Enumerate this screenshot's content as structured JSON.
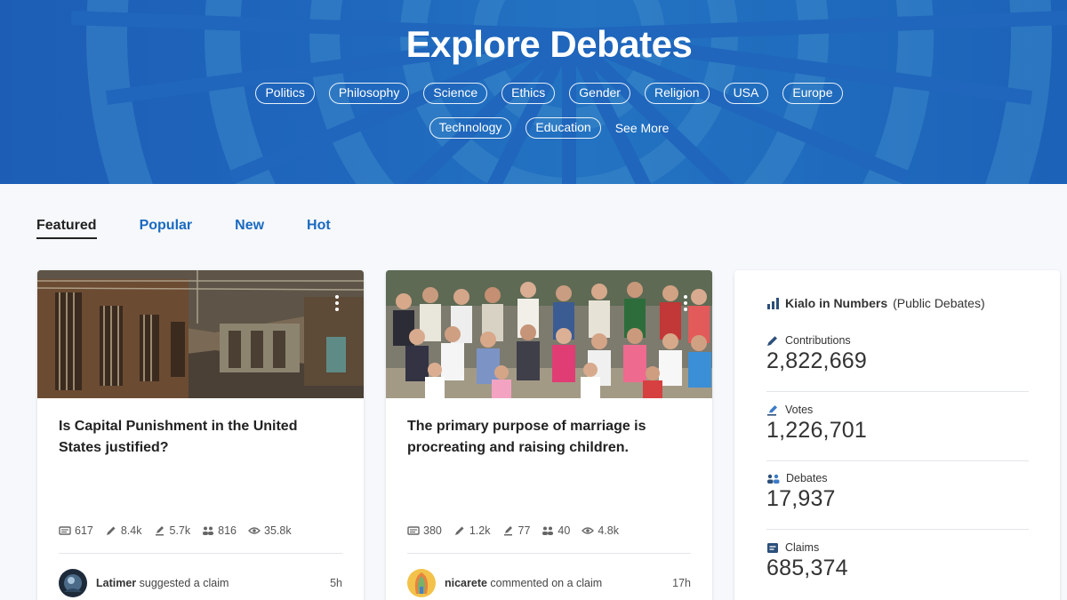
{
  "hero": {
    "title": "Explore Debates",
    "topics_row1": [
      "Politics",
      "Philosophy",
      "Science",
      "Ethics",
      "Gender",
      "Religion",
      "USA",
      "Europe"
    ],
    "topics_row2": [
      "Technology",
      "Education"
    ],
    "see_more": "See More"
  },
  "tabs": [
    "Featured",
    "Popular",
    "New",
    "Hot"
  ],
  "active_tab": "Featured",
  "cards": [
    {
      "title": "Is Capital Punishment in the United States justified?",
      "stats": {
        "claims": "617",
        "contributions": "8.4k",
        "votes": "5.7k",
        "participants": "816",
        "views": "35.8k"
      },
      "activity": {
        "user": "Latimer",
        "action": " suggested a claim",
        "time": "5h"
      }
    },
    {
      "title": "The primary purpose of marriage is procreating and raising children.",
      "stats": {
        "claims": "380",
        "contributions": "1.2k",
        "votes": "77",
        "participants": "40",
        "views": "4.8k"
      },
      "activity": {
        "user": "nicarete",
        "action": " commented on a claim",
        "time": "17h"
      }
    }
  ],
  "numbers": {
    "title": "Kialo in Numbers",
    "subtitle": "(Public Debates)",
    "items": [
      {
        "label": "Contributions",
        "value": "2,822,669",
        "icon": "pencil-icon"
      },
      {
        "label": "Votes",
        "value": "1,226,701",
        "icon": "vote-icon"
      },
      {
        "label": "Debates",
        "value": "17,937",
        "icon": "people-icon"
      },
      {
        "label": "Claims",
        "value": "685,374",
        "icon": "claims-icon"
      }
    ]
  },
  "colors": {
    "hero_blue": "#1f68bd",
    "link_blue": "#1a6ac1",
    "text": "#222222"
  }
}
